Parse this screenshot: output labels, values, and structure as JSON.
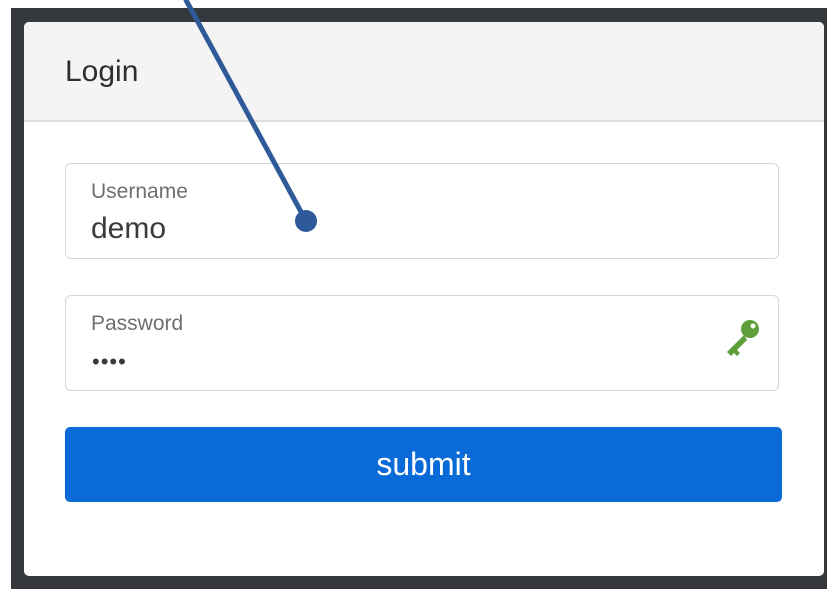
{
  "login_card": {
    "title": "Login",
    "username": {
      "label": "Username",
      "value": "demo"
    },
    "password": {
      "label": "Password",
      "masked_value": "••••",
      "icon": "key-icon"
    },
    "submit_label": "submit"
  },
  "colors": {
    "frame": "#34373b",
    "header_background": "#f4f4f4",
    "submit_button": "#0a6ad8",
    "key_icon": "#5f9f3b",
    "pointer": "#2f5a9a"
  }
}
